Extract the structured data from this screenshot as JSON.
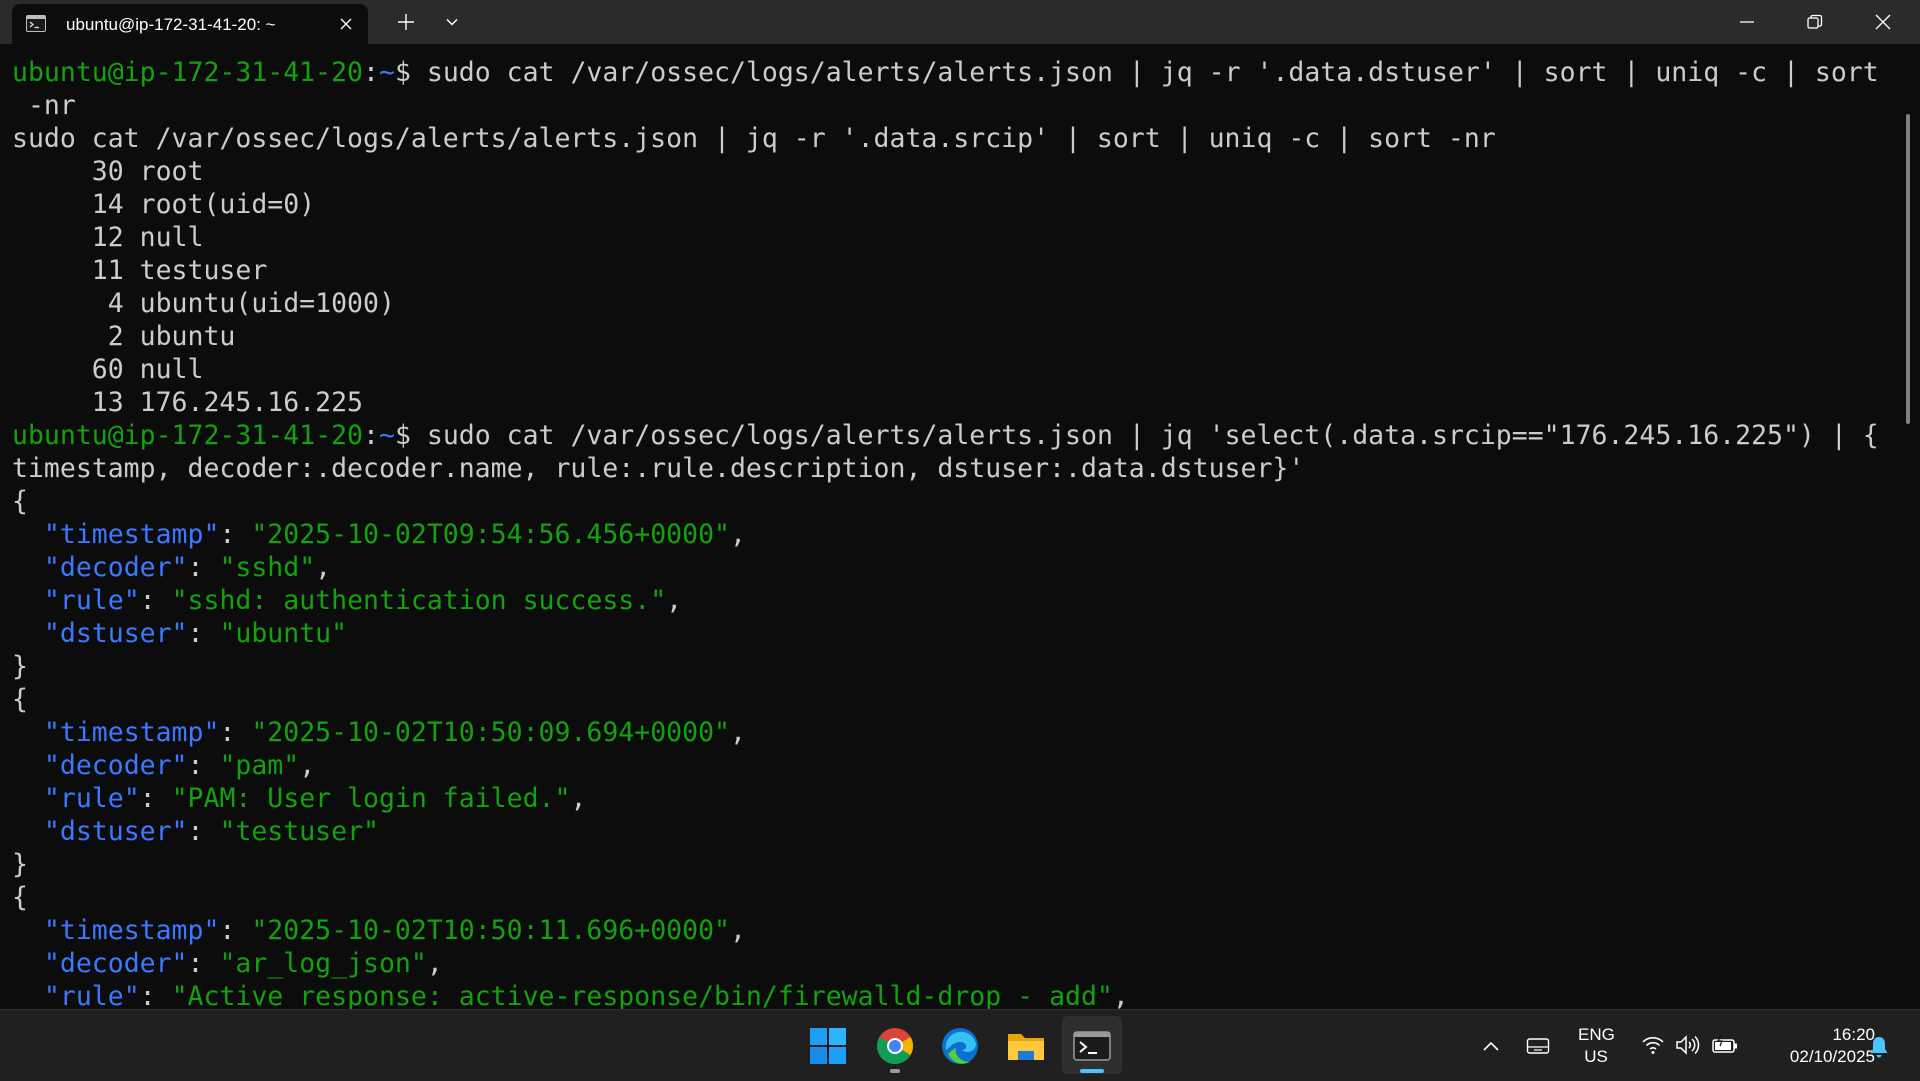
{
  "window": {
    "tab_title": "ubuntu@ip-172-31-41-20: ~",
    "new_tab_label": "+",
    "icons": [
      "terminal-icon",
      "close-icon",
      "plus-icon",
      "chevron-down-icon",
      "minimize-icon",
      "maximize-icon",
      "close-icon"
    ]
  },
  "terminal": {
    "colors": {
      "background": "#0c0c0c",
      "text": "#cccccc",
      "prompt_user": "#13a10e",
      "prompt_path": "#3b78ff",
      "json_key": "#3b78ff",
      "json_string": "#13a10e"
    },
    "prompt": {
      "user_host": "ubuntu@ip-172-31-41-20",
      "sep": ":",
      "path": "~",
      "symbol": "$ "
    },
    "cmd1_line1": "sudo cat /var/ossec/logs/alerts/alerts.json | jq -r '.data.dstuser' | sort | uniq -c | sort",
    "cmd1_line2": " -nr",
    "cmd2": "sudo cat /var/ossec/logs/alerts/alerts.json | jq -r '.data.srcip' | sort | uniq -c | sort -nr",
    "counts": [
      "     30 root",
      "     14 root(uid=0)",
      "     12 null",
      "     11 testuser",
      "      4 ubuntu(uid=1000)",
      "      2 ubuntu",
      "     60 null",
      "     13 176.245.16.225"
    ],
    "cmd3_line1": "sudo cat /var/ossec/logs/alerts/alerts.json | jq 'select(.data.srcip==\"176.245.16.225\") | {",
    "cmd3_line2": "timestamp, decoder:.decoder.name, rule:.rule.description, dstuser:.data.dstuser}'",
    "open_brace": "{",
    "close_brace": "}",
    "colon": ": ",
    "comma": ",",
    "indent": "  ",
    "records": [
      {
        "k1": "\"timestamp\"",
        "v1": "\"2025-10-02T09:54:56.456+0000\"",
        "k2": "\"decoder\"",
        "v2": "\"sshd\"",
        "k3": "\"rule\"",
        "v3": "\"sshd: authentication success.\"",
        "k4": "\"dstuser\"",
        "v4": "\"ubuntu\""
      },
      {
        "k1": "\"timestamp\"",
        "v1": "\"2025-10-02T10:50:09.694+0000\"",
        "k2": "\"decoder\"",
        "v2": "\"pam\"",
        "k3": "\"rule\"",
        "v3": "\"PAM: User login failed.\"",
        "k4": "\"dstuser\"",
        "v4": "\"testuser\""
      },
      {
        "k1": "\"timestamp\"",
        "v1": "\"2025-10-02T10:50:11.696+0000\"",
        "k2": "\"decoder\"",
        "v2": "\"ar_log_json\"",
        "k3": "\"rule\"",
        "v3": "\"Active response: active-response/bin/firewalld-drop - add\""
      }
    ]
  },
  "taskbar": {
    "apps": [
      "windows-start-icon",
      "chrome-icon",
      "edge-icon",
      "file-explorer-icon",
      "terminal-icon"
    ],
    "tray": {
      "lang_top": "ENG",
      "lang_bottom": "US",
      "time": "16:20",
      "date": "02/10/2025",
      "icons": [
        "chevron-up-icon",
        "touch-keyboard-icon",
        "wifi-icon",
        "volume-icon",
        "battery-icon",
        "notification-bell-icon"
      ]
    }
  }
}
